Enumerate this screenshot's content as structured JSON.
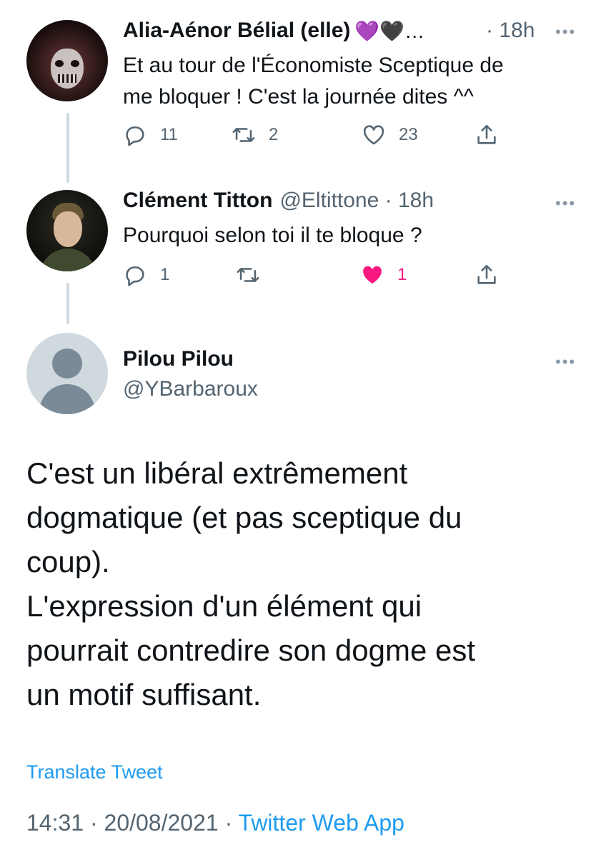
{
  "tweets": [
    {
      "name": "Alia-Aénor Bélial (elle)",
      "emojis": "💜🖤…",
      "time": "· 18h",
      "text_line1": "Et au tour de l'Économiste Sceptique de",
      "text_line2": "me bloquer ! C'est la journée dites ^^",
      "replies": "11",
      "retweets": "2",
      "likes": "23"
    },
    {
      "name": "Clément Titton",
      "handle_time": "@Eltittone · 18h",
      "text": "Pourquoi selon toi il te bloque ?",
      "replies": "1",
      "likes": "1"
    }
  ],
  "main": {
    "name": "Pilou Pilou",
    "handle": "@YBarbaroux",
    "text_lines": [
      "C'est un libéral extrêmement",
      "dogmatique (et pas sceptique du",
      "coup).",
      "L'expression d'un élément qui",
      "pourrait contredire son dogme est",
      "un motif suffisant."
    ],
    "translate": "Translate Tweet",
    "timestamp": "14:31 · 20/08/2021 · ",
    "source": "Twitter Web App"
  },
  "more_glyph": "•••",
  "colors": {
    "accent": "#1d9bf0",
    "like_active": "#f91880",
    "muted": "#536471",
    "thread_line": "#cfd9de"
  }
}
